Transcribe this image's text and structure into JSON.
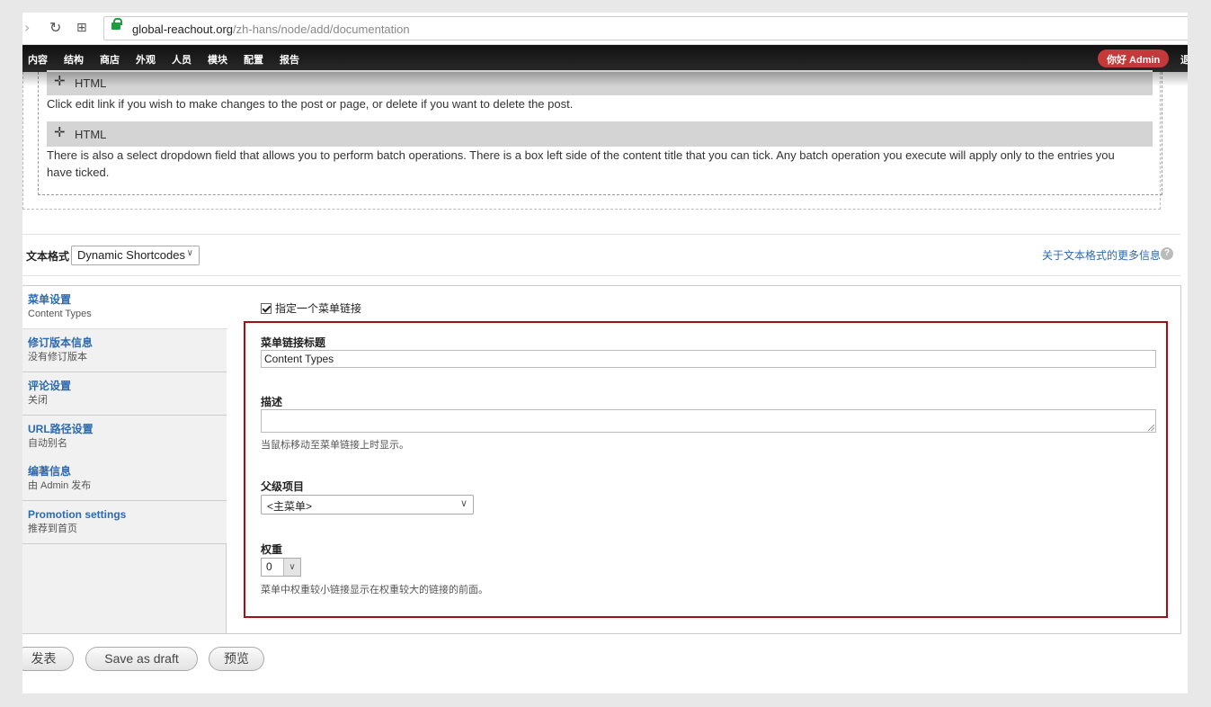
{
  "browser": {
    "url_host": "global-reachout.org",
    "url_path": "/zh-hans/node/add/documentation"
  },
  "toolbar": {
    "menu": [
      "内容",
      "结构",
      "商店",
      "外观",
      "人员",
      "模块",
      "配置",
      "报告"
    ],
    "hello": "你好 Admin",
    "logout": "退"
  },
  "body_blocks": [
    {
      "label": "HTML",
      "text": "Click edit link if you wish to make changes to the post or page, or delete if you want to delete the post."
    },
    {
      "label": "HTML",
      "text": "There is also a select dropdown field that allows you to perform batch operations. There is a box left side of the content title that you can tick. Any batch operation you execute will apply only to the entries you have ticked."
    }
  ],
  "text_format": {
    "label": "文本格式",
    "selected": "Dynamic Shortcodes",
    "help_link": "关于文本格式的更多信息",
    "help_icon": "?"
  },
  "vertical_tabs": [
    {
      "title": "菜单设置",
      "summary": "Content Types"
    },
    {
      "title": "修订版本信息",
      "summary": "没有修订版本"
    },
    {
      "title": "评论设置",
      "summary": "关闭"
    },
    {
      "title": "URL路径设置",
      "summary": "自动别名"
    },
    {
      "title": "编著信息",
      "summary": "由 Admin 发布"
    },
    {
      "title": "Promotion settings",
      "summary": "推荐到首页"
    }
  ],
  "menu_settings": {
    "checkbox_label": "指定一个菜单链接",
    "checkbox_checked": true,
    "title_label": "菜单链接标题",
    "title_value": "Content Types",
    "desc_label": "描述",
    "desc_value": "",
    "desc_help": "当鼠标移动至菜单链接上时显示。",
    "parent_label": "父级项目",
    "parent_value": "<主菜单>",
    "weight_label": "权重",
    "weight_value": "0",
    "weight_help": "菜单中权重较小链接显示在权重较大的链接的前面。"
  },
  "actions": {
    "publish": "发表",
    "draft": "Save as draft",
    "preview": "预览"
  },
  "colors": {
    "highlight_border": "#a60d15",
    "link": "#2c6ab0",
    "hello_badge": "#c43939",
    "secure_lock": "#1e9e3e"
  }
}
